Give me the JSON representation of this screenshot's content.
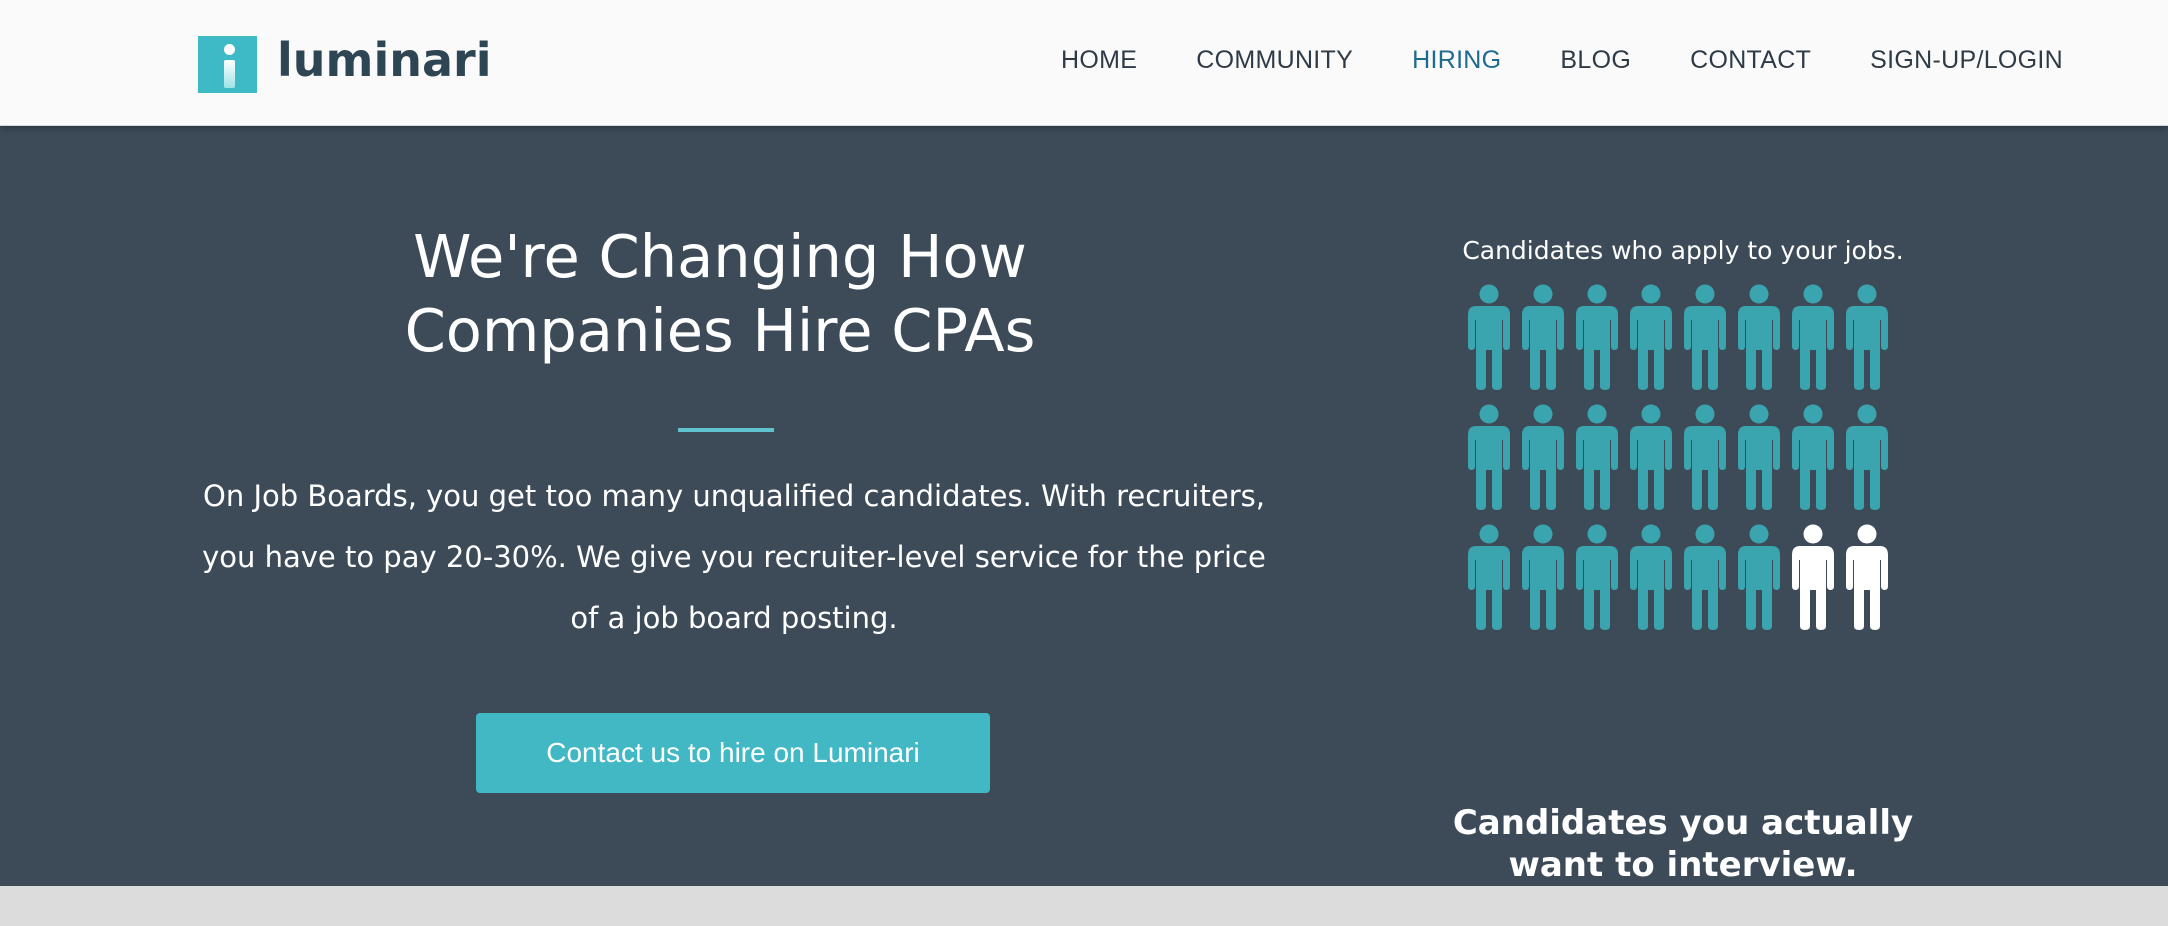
{
  "brand": {
    "name": "luminari",
    "accent": "#3dbac6",
    "dark": "#2e4553"
  },
  "nav": {
    "items": [
      {
        "label": "HOME",
        "active": false
      },
      {
        "label": "COMMUNITY",
        "active": false
      },
      {
        "label": "HIRING",
        "active": true
      },
      {
        "label": "BLOG",
        "active": false
      },
      {
        "label": "CONTACT",
        "active": false
      },
      {
        "label": "SIGN-UP/LOGIN",
        "active": false
      }
    ]
  },
  "hero": {
    "headline_line1": "We're Changing How",
    "headline_line2": "Companies Hire CPAs",
    "body": "On Job Boards, you get too many unqualified candidates. With recruiters, you have to pay 20-30%. We give you recruiter-level service for the price of a job board posting.",
    "cta_label": "Contact us to hire on Luminari",
    "background": "#3d4b59"
  },
  "infographic": {
    "caption": "Candidates who apply to your jobs.",
    "tagline_line1": "Candidates you actually",
    "tagline_line2": "want to interview.",
    "total_people": 24,
    "highlighted_people": 2,
    "person_icon": "person-icon",
    "person_color": "#3aa5ae",
    "highlight_color": "#ffffff"
  }
}
